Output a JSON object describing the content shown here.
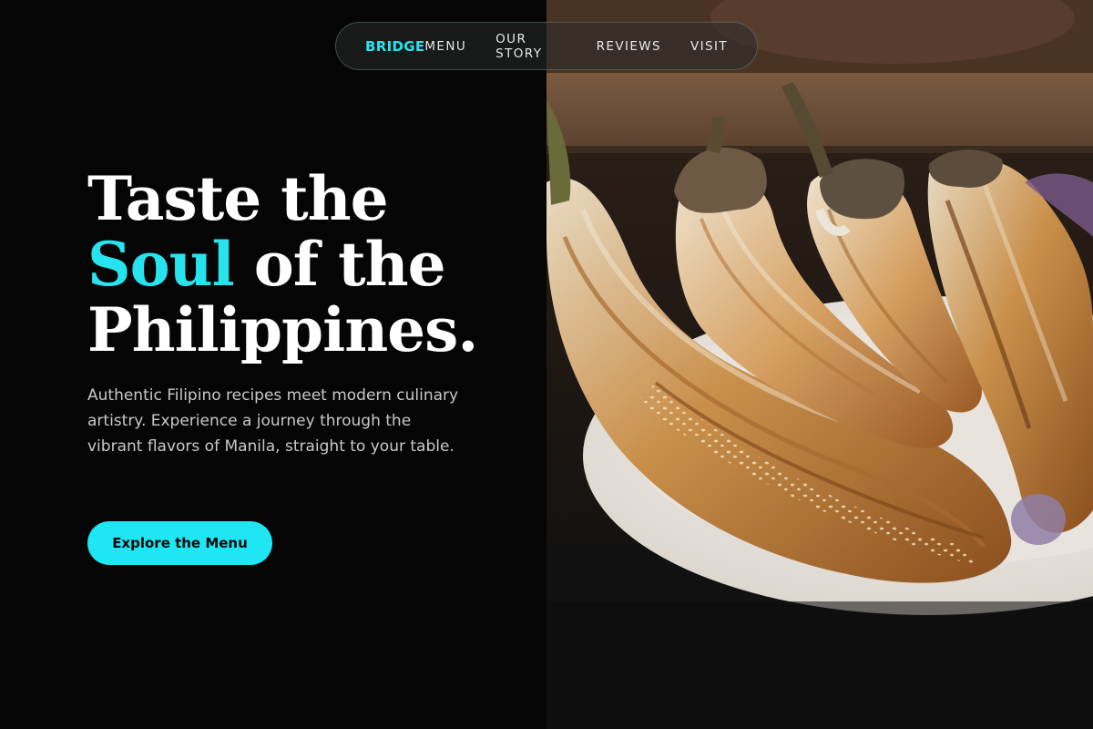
{
  "nav": {
    "brand": "BRIDGE",
    "links": [
      "MENU",
      "OUR STORY",
      "REVIEWS",
      "VISIT"
    ]
  },
  "hero": {
    "title_line1": "Taste the",
    "title_accent": "Soul",
    "title_line2_rest": " of the",
    "title_line3": "Philippines.",
    "description": "Authentic Filipino recipes meet modern culinary artistry. Experience a journey through the vibrant flavors of Manila, straight to your table.",
    "cta_label": "Explore the Menu"
  },
  "colors": {
    "accent": "#27e3ee",
    "background": "#050505",
    "cta_bg": "#1ee6f2"
  }
}
